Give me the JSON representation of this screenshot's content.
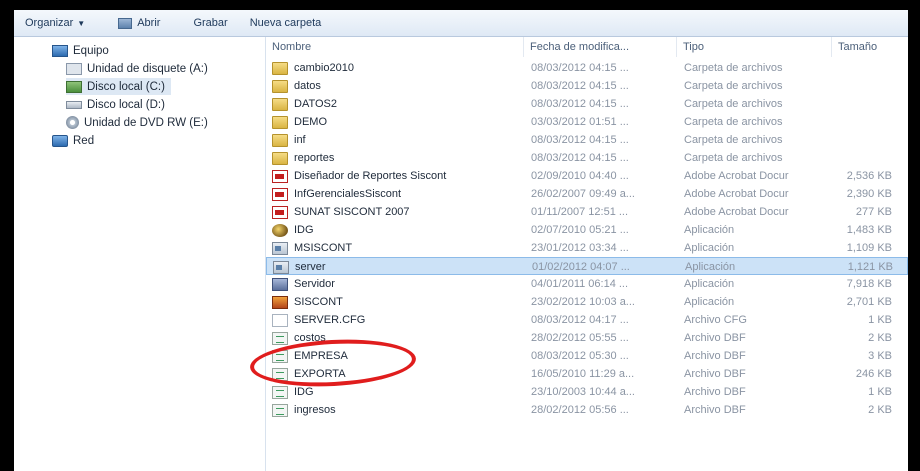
{
  "toolbar": {
    "organize": "Organizar",
    "open": "Abrir",
    "burn": "Grabar",
    "new_folder": "Nueva carpeta"
  },
  "nav": {
    "items": [
      {
        "label": "Equipo",
        "icon": "computer-icon"
      },
      {
        "label": "Unidad de disquete (A:)",
        "icon": "floppy-icon"
      },
      {
        "label": "Disco local (C:)",
        "icon": "local-disk-icon",
        "selected": true
      },
      {
        "label": "Disco local (D:)",
        "icon": "local-disk-icon"
      },
      {
        "label": "Unidad de DVD RW (E:)",
        "icon": "dvd-icon"
      },
      {
        "label": "Red",
        "icon": "network-icon"
      }
    ]
  },
  "columns": {
    "name": "Nombre",
    "date": "Fecha de modifica...",
    "type": "Tipo",
    "size": "Tamaño"
  },
  "files": [
    {
      "name": "cambio2010",
      "date": "08/03/2012 04:15 ...",
      "type": "Carpeta de archivos",
      "size": "",
      "icon": "folder-icon"
    },
    {
      "name": "datos",
      "date": "08/03/2012 04:15 ...",
      "type": "Carpeta de archivos",
      "size": "",
      "icon": "folder-icon"
    },
    {
      "name": "DATOS2",
      "date": "08/03/2012 04:15 ...",
      "type": "Carpeta de archivos",
      "size": "",
      "icon": "folder-icon"
    },
    {
      "name": "DEMO",
      "date": "03/03/2012 01:51 ...",
      "type": "Carpeta de archivos",
      "size": "",
      "icon": "folder-icon"
    },
    {
      "name": "inf",
      "date": "08/03/2012 04:15 ...",
      "type": "Carpeta de archivos",
      "size": "",
      "icon": "folder-icon"
    },
    {
      "name": "reportes",
      "date": "08/03/2012 04:15 ...",
      "type": "Carpeta de archivos",
      "size": "",
      "icon": "folder-icon"
    },
    {
      "name": "Diseñador de Reportes Siscont",
      "date": "02/09/2010 04:40 ...",
      "type": "Adobe Acrobat Docur",
      "size": "2,536 KB",
      "icon": "pdf-icon"
    },
    {
      "name": "InfGerencialesSiscont",
      "date": "26/02/2007 09:49 a...",
      "type": "Adobe Acrobat Docur",
      "size": "2,390 KB",
      "icon": "pdf-icon"
    },
    {
      "name": "SUNAT SISCONT 2007",
      "date": "01/11/2007 12:51 ...",
      "type": "Adobe Acrobat Docur",
      "size": "277 KB",
      "icon": "pdf-icon"
    },
    {
      "name": "IDG",
      "date": "02/07/2010 05:21 ...",
      "type": "Aplicación",
      "size": "1,483 KB",
      "icon": "idg-app-icon"
    },
    {
      "name": "MSISCONT",
      "date": "23/01/2012 03:34 ...",
      "type": "Aplicación",
      "size": "1,109 KB",
      "icon": "application-icon"
    },
    {
      "name": "server",
      "date": "01/02/2012 04:07 ...",
      "type": "Aplicación",
      "size": "1,121 KB",
      "icon": "application-icon",
      "selected": true
    },
    {
      "name": "Servidor",
      "date": "04/01/2011 06:14 ...",
      "type": "Aplicación",
      "size": "7,918 KB",
      "icon": "server-app-icon"
    },
    {
      "name": "SISCONT",
      "date": "23/02/2012 10:03 a...",
      "type": "Aplicación",
      "size": "2,701 KB",
      "icon": "siscont-app-icon"
    },
    {
      "name": "SERVER.CFG",
      "date": "08/03/2012 04:17 ...",
      "type": "Archivo CFG",
      "size": "1 KB",
      "icon": "cfg-file-icon"
    },
    {
      "name": "costos",
      "date": "28/02/2012 05:55 ...",
      "type": "Archivo DBF",
      "size": "2 KB",
      "icon": "dbf-file-icon"
    },
    {
      "name": "EMPRESA",
      "date": "08/03/2012 05:30 ...",
      "type": "Archivo DBF",
      "size": "3 KB",
      "icon": "dbf-file-icon"
    },
    {
      "name": "EXPORTA",
      "date": "16/05/2010 11:29 a...",
      "type": "Archivo DBF",
      "size": "246 KB",
      "icon": "dbf-file-icon"
    },
    {
      "name": "IDG",
      "date": "23/10/2003 10:44 a...",
      "type": "Archivo DBF",
      "size": "1 KB",
      "icon": "dbf-file-icon"
    },
    {
      "name": "ingresos",
      "date": "28/02/2012 05:56 ...",
      "type": "Archivo DBF",
      "size": "2 KB",
      "icon": "dbf-file-icon"
    }
  ],
  "annotation": {
    "highlight_color": "#e01d1d",
    "highlighted_file": "SERVER.CFG"
  }
}
